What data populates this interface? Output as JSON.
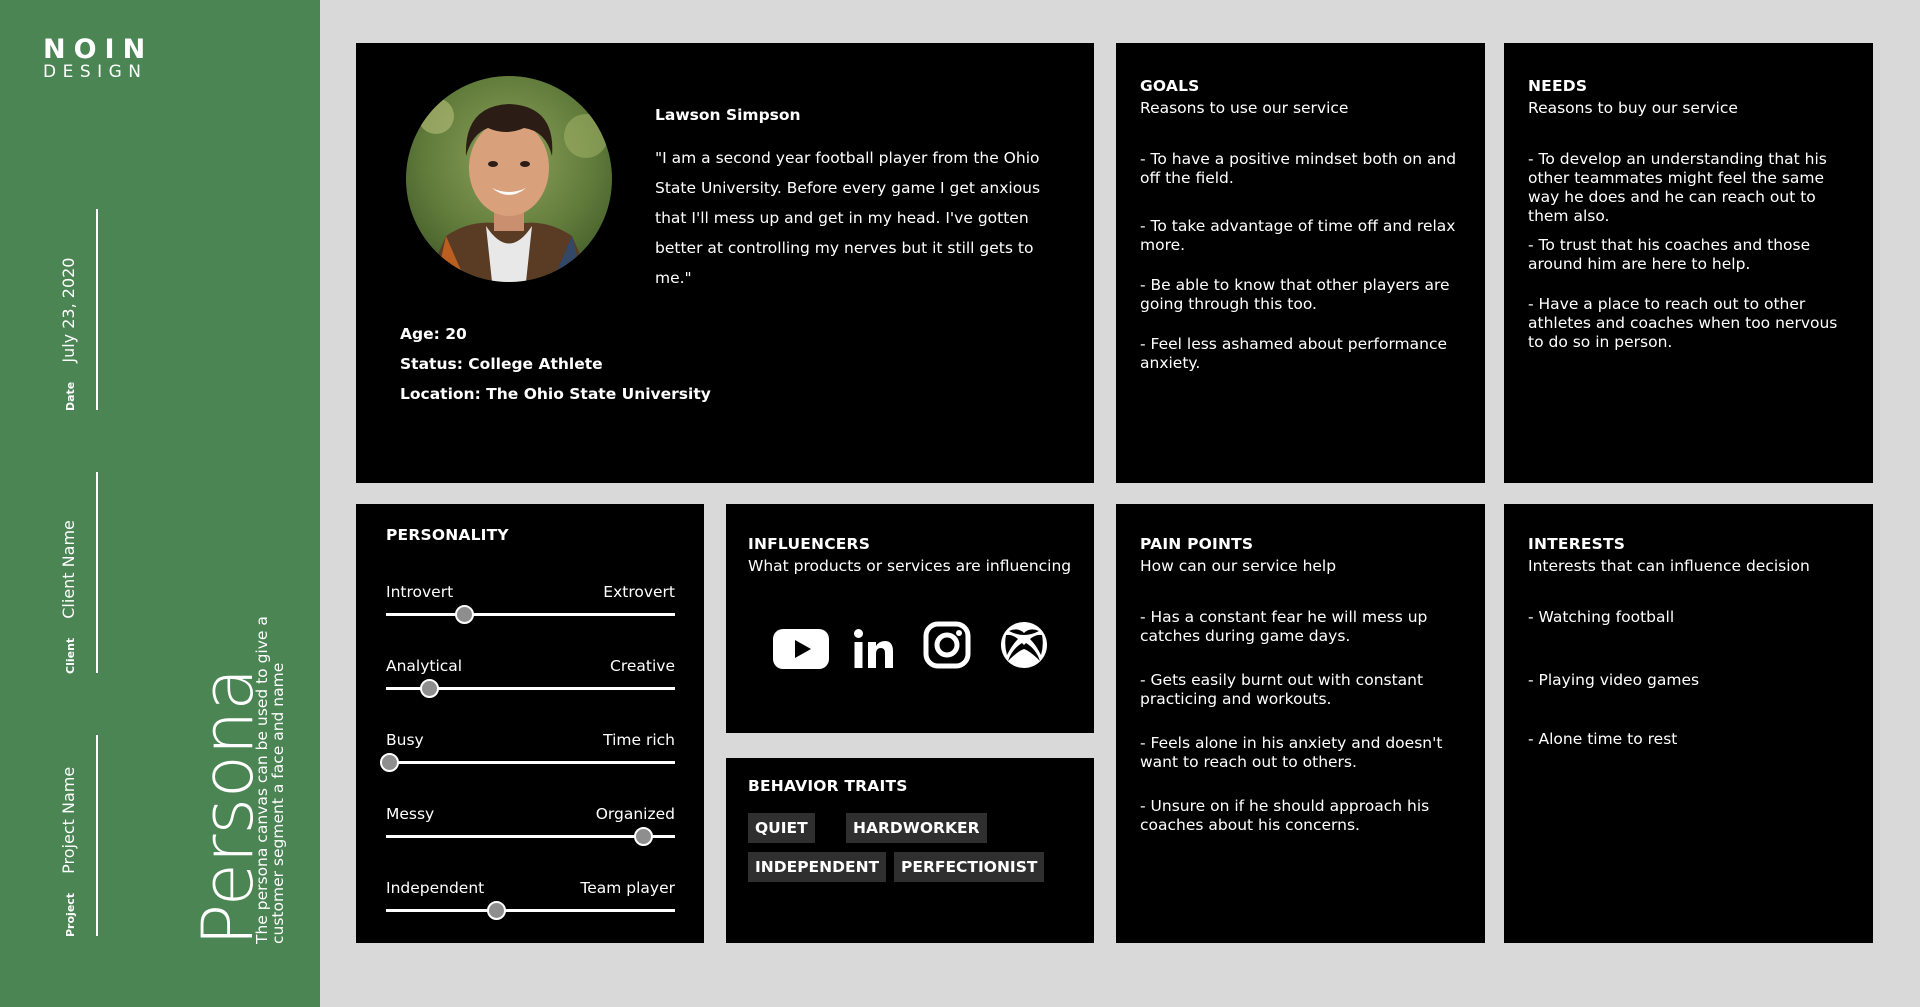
{
  "brand": {
    "line1": "NOIN",
    "line2": "DESIGN"
  },
  "sidebar": {
    "date": {
      "label": "Date",
      "value": "July 23, 2020"
    },
    "client": {
      "label": "Client",
      "value": "Client Name"
    },
    "project": {
      "label": "Project",
      "value": "Project Name"
    },
    "title": "Persona",
    "description": "The persona canvas can be used to give a customer segment a face and name"
  },
  "profile": {
    "name": "Lawson Simpson",
    "quote": "\"I am a second year football player from the Ohio State University. Before every game I get anxious that I'll mess up and get in my head. I've gotten better at controlling my nerves but it still gets to me.\"",
    "age": "Age: 20",
    "status": "Status: College Athlete",
    "location": "Location: The Ohio State University"
  },
  "goals": {
    "title": "GOALS",
    "subtitle": "Reasons to use our service",
    "items": [
      "- To have a positive mindset both on and off the field.",
      "- To take advantage of time off and relax more.",
      "- Be able to know that other players are going through this too.",
      "- Feel less ashamed about performance anxiety."
    ]
  },
  "needs": {
    "title": "NEEDS",
    "subtitle": "Reasons to buy our service",
    "items": [
      "- To develop an understanding that his other teammates might feel the same way he does and he can reach out to them also.",
      "- To trust that his coaches and those around him are here to help.",
      "- Have a place to reach out to other athletes and coaches when too nervous to do so in person."
    ]
  },
  "personality": {
    "title": "PERSONALITY",
    "sliders": [
      {
        "left": "Introvert",
        "right": "Extrovert",
        "value": 0.27
      },
      {
        "left": "Analytical",
        "right": "Creative",
        "value": 0.15
      },
      {
        "left": "Busy",
        "right": "Time rich",
        "value": 0.01
      },
      {
        "left": "Messy",
        "right": "Organized",
        "value": 0.89
      },
      {
        "left": "Independent",
        "right": "Team player",
        "value": 0.38
      }
    ]
  },
  "influencers": {
    "title": "INFLUENCERS",
    "subtitle": "What products or services are influencing",
    "icons": [
      "youtube-icon",
      "linkedin-icon",
      "instagram-icon",
      "xbox-icon"
    ]
  },
  "behavior": {
    "title": "BEHAVIOR TRAITS",
    "tags": [
      "QUIET",
      "HARDWORKER",
      "INDEPENDENT",
      "PERFECTIONIST"
    ]
  },
  "pain_points": {
    "title": "PAIN POINTS",
    "subtitle": "How can our service help",
    "items": [
      "- Has a constant fear he will mess up catches during game days.",
      "- Gets easily burnt out with constant practicing and workouts.",
      "- Feels alone in his anxiety and doesn't want to reach out to others.",
      "- Unsure on if he should approach his coaches about his concerns."
    ]
  },
  "interests": {
    "title": "INTERESTS",
    "subtitle": "Interests that can influence decision",
    "items": [
      "- Watching football",
      "- Playing video games",
      "- Alone time to rest"
    ]
  },
  "colors": {
    "sidebar": "#4a8553",
    "background": "#d9d9d9",
    "card": "#000000",
    "tag": "#2f2f2f"
  }
}
